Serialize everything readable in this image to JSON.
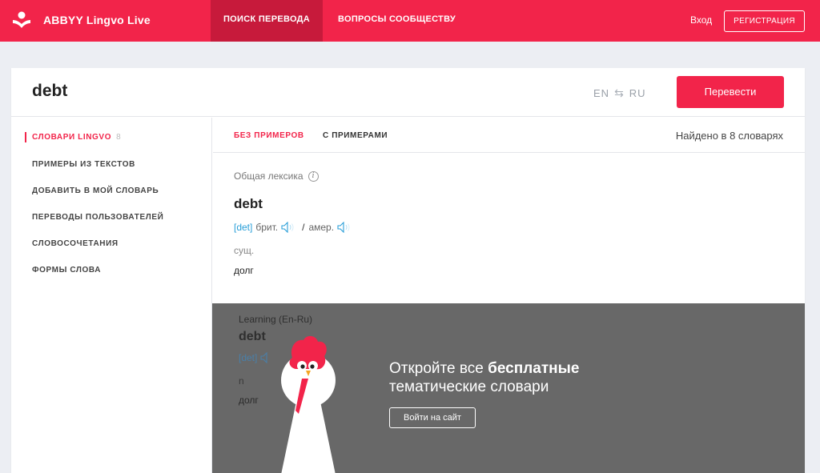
{
  "header": {
    "logo_text": "ABBYY Lingvo Live",
    "nav": {
      "search": "Поиск перевода",
      "community": "Вопросы сообществу"
    },
    "login": "Вход",
    "register": "Регистрация"
  },
  "search": {
    "query": "debt",
    "lang_from": "EN",
    "lang_swap": "⇆",
    "lang_to": "RU",
    "translate_button": "Перевести"
  },
  "sidebar": {
    "items": [
      {
        "label": "Словари Lingvo",
        "count": "8"
      },
      {
        "label": "Примеры из текстов"
      },
      {
        "label": "Добавить в мой словарь"
      },
      {
        "label": "Переводы пользователей"
      },
      {
        "label": "Словосочетания"
      },
      {
        "label": "Формы слова"
      }
    ]
  },
  "results": {
    "tab_no_examples": "Без примеров",
    "tab_with_examples": "С примерами",
    "found": "Найдено в 8 словарях",
    "entry": {
      "dictionary": "Общая лексика",
      "info_icon": "i",
      "word": "debt",
      "transcription": "[det]",
      "brit_label": "брит.",
      "separator": "/",
      "amer_label": "амер.",
      "part_of_speech": "сущ.",
      "translation": "долг"
    }
  },
  "promo": {
    "dictionary": "Learning (En-Ru)",
    "word": "debt",
    "transcription": "[det]",
    "part_of_speech": "n",
    "translation": "долг",
    "headline_normal": "Откройте все ",
    "headline_bold": "бесплатные",
    "headline_line2": "тематические словари",
    "button": "Войти на сайт"
  },
  "colors": {
    "brand": "#f2244a",
    "brand_dark": "#c71a3b",
    "link": "#2a9fd8",
    "promo_bg": "#686868"
  },
  "icons": [
    "lingvo-logo-icon",
    "swap-arrows-icon",
    "info-icon",
    "speaker-icon",
    "mascot-bird"
  ]
}
